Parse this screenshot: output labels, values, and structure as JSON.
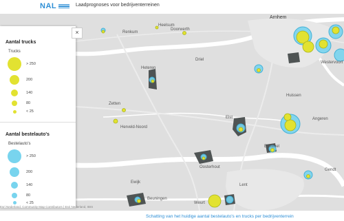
{
  "header": {
    "logo_text": "NAL",
    "title": "Laadprognoses voor bedrijventerreinen"
  },
  "map": {
    "places": [
      {
        "name": "Heelsum"
      },
      {
        "name": "Doorwerth"
      },
      {
        "name": "Arnhem"
      },
      {
        "name": "Westervoort"
      },
      {
        "name": "Renkum"
      },
      {
        "name": "Driel"
      },
      {
        "name": "Heteren"
      },
      {
        "name": "Huissen"
      },
      {
        "name": "Angeren"
      },
      {
        "name": "Zetten"
      },
      {
        "name": "Herveld-Noord"
      },
      {
        "name": "Elst"
      },
      {
        "name": "Bemmel"
      },
      {
        "name": "Gendt"
      },
      {
        "name": "Oosterhout"
      },
      {
        "name": "Lent"
      },
      {
        "name": "Ewijk"
      },
      {
        "name": "Beuningen"
      },
      {
        "name": "Weurt"
      }
    ],
    "close_label": "×",
    "attribution": "Esri Nederland, Community Map Contributors | Esri Nederland, IBIS",
    "colors": {
      "truck": "#e2e231",
      "truck_stroke": "#a9b41a",
      "van": "#78d4ee",
      "van_stroke": "#43b0d6",
      "industrial": "#4f5454",
      "water": "#ffffff",
      "land": "#dfdfdf"
    }
  },
  "legend": {
    "trucks_title": "Aantal trucks",
    "trucks_sub": "Trucks",
    "trucks_items": [
      {
        "label": "> 250",
        "size": 5
      },
      {
        "label": "200",
        "size": 4
      },
      {
        "label": "140",
        "size": 3
      },
      {
        "label": "80",
        "size": 2
      },
      {
        "label": "< 25",
        "size": 1
      }
    ],
    "vans_title": "Aantal bestelauto's",
    "vans_sub": "Bestelauto's",
    "vans_items": [
      {
        "label": "> 250",
        "size": 5
      },
      {
        "label": "200",
        "size": 4
      },
      {
        "label": "140",
        "size": 3
      },
      {
        "label": "80",
        "size": 2
      },
      {
        "label": "< 25",
        "size": 1
      }
    ]
  },
  "caption": "Schatting van het huidige aantal bestelauto's en trucks per bedrijventerrein"
}
